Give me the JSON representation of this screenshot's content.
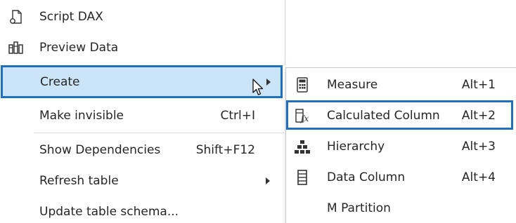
{
  "menu": {
    "items": [
      {
        "label": "Script DAX",
        "icon": "script-dax-icon",
        "shortcut": "",
        "has_submenu": false
      },
      {
        "label": "Preview Data",
        "icon": "preview-data-icon",
        "shortcut": "",
        "has_submenu": false
      },
      {
        "label": "Create",
        "icon": "",
        "shortcut": "",
        "has_submenu": true,
        "highlighted": true
      },
      {
        "label": "Make invisible",
        "icon": "",
        "shortcut": "Ctrl+I",
        "has_submenu": false
      },
      {
        "label": "Show Dependencies",
        "icon": "",
        "shortcut": "Shift+F12",
        "has_submenu": false
      },
      {
        "label": "Refresh table",
        "icon": "",
        "shortcut": "",
        "has_submenu": true
      },
      {
        "label": "Update table schema...",
        "icon": "",
        "shortcut": "",
        "has_submenu": false
      }
    ]
  },
  "submenu": {
    "items": [
      {
        "label": "Measure",
        "icon": "calculator-icon",
        "shortcut": "Alt+1"
      },
      {
        "label": "Calculated Column",
        "icon": "calculated-column-icon",
        "shortcut": "Alt+2",
        "highlighted": true
      },
      {
        "label": "Hierarchy",
        "icon": "hierarchy-icon",
        "shortcut": "Alt+3"
      },
      {
        "label": "Data Column",
        "icon": "data-column-icon",
        "shortcut": "Alt+4"
      },
      {
        "label": "M Partition",
        "icon": "",
        "shortcut": ""
      }
    ]
  },
  "colors": {
    "highlight_fill": "#cce4f7",
    "highlight_border": "#1f6fbf",
    "text": "#262626"
  }
}
